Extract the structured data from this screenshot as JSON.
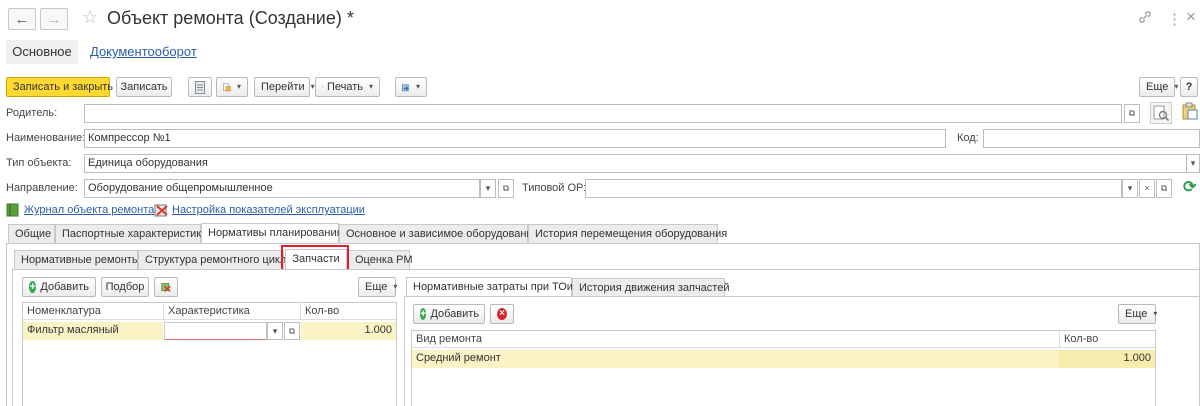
{
  "window": {
    "title": "Объект ремонта (Создание) *",
    "back_label": "←",
    "forward_label": "→",
    "star_glyph": "☆",
    "link_glyph": "🔗",
    "menu_glyph": "⋮",
    "close_glyph": "×"
  },
  "sections": {
    "main": "Основное",
    "docflow": "Документооборот"
  },
  "toolbar": {
    "save_close": "Записать и закрыть",
    "save": "Записать",
    "goto": "Перейти",
    "print": "Печать",
    "more": "Еще",
    "help": "?"
  },
  "form": {
    "parent_label": "Родитель:",
    "parent_value": "",
    "name_label": "Наименование:",
    "name_value": "Компрессор №1",
    "code_label": "Код:",
    "code_value": "",
    "type_label": "Тип объекта:",
    "type_value": "Единица оборудования",
    "direction_label": "Направление:",
    "direction_value": "Оборудование общепромышленное",
    "typical_label": "Типовой ОР:",
    "typical_value": ""
  },
  "links": {
    "journal": "Журнал объекта ремонта",
    "settings": "Настройка показателей эксплуатации"
  },
  "tabs_main": [
    "Общие",
    "Паспортные характеристики",
    "Нормативы планирования",
    "Основное и зависимое оборудование",
    "История перемещения оборудования"
  ],
  "tabs_sub": [
    "Нормативные ремонты",
    "Структура ремонтного цикла",
    "Запчасти",
    "Оценка РМ"
  ],
  "parts": {
    "add": "Добавить",
    "pick": "Подбор",
    "more": "Еще",
    "columns": [
      "Номенклатура",
      "Характеристика",
      "Кол-во"
    ],
    "rows": [
      {
        "item": "Фильтр масляный",
        "char": "",
        "qty": "1.000"
      }
    ]
  },
  "costs": {
    "tabs": [
      "Нормативные затраты при ТОиР",
      "История движения запчастей"
    ],
    "add": "Добавить",
    "more": "Еще",
    "columns": [
      "Вид ремонта",
      "Кол-во"
    ],
    "rows": [
      {
        "kind": "Средний ремонт",
        "qty": "1.000"
      }
    ]
  },
  "colors": {
    "accent_yellow": "#ffd932",
    "link_blue": "#2a5ea8",
    "highlight_red": "#e0212b",
    "row_yellow": "#faf3c5"
  }
}
